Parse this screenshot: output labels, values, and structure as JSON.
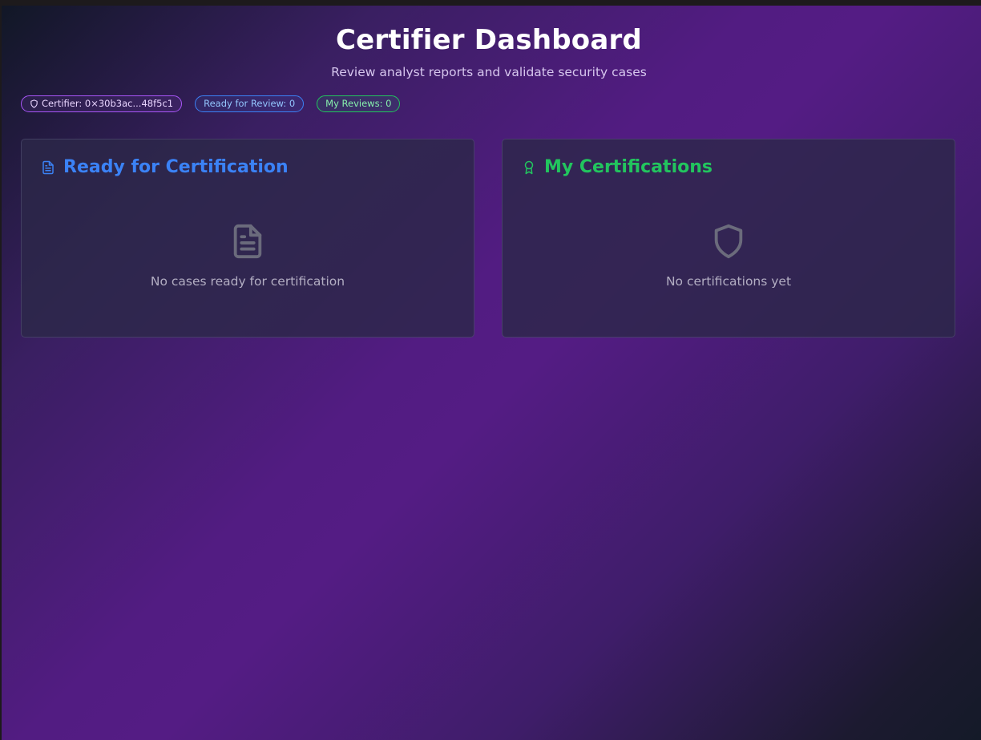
{
  "header": {
    "title": "Certifier Dashboard",
    "subtitle": "Review analyst reports and validate security cases"
  },
  "badges": {
    "certifier": {
      "label": "Certifier: 0×30b3ac...48f5c1",
      "icon": "shield-icon",
      "color": "#a855f7"
    },
    "ready": {
      "label": "Ready for Review: 0",
      "color": "#3b82f6"
    },
    "reviews": {
      "label": "My Reviews: 0",
      "color": "#22c55e"
    }
  },
  "ready_card": {
    "title": "Ready for Certification",
    "icon": "file-text-icon",
    "accent": "#3b82f6",
    "empty_icon": "file-text-icon",
    "empty_text": "No cases ready for certification"
  },
  "cert_card": {
    "title": "My Certifications",
    "icon": "award-icon",
    "accent": "#22c55e",
    "empty_icon": "shield-icon",
    "empty_text": "No certifications yet"
  }
}
